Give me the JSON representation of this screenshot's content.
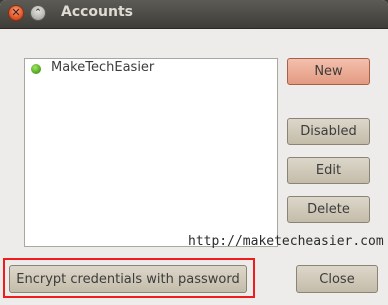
{
  "window": {
    "title": "Accounts",
    "close_glyph": "✕",
    "minimize_glyph": "⌃"
  },
  "accounts": [
    {
      "name": "MakeTechEasier",
      "status_icon": "online-status-icon",
      "status_color": "#4aa117"
    }
  ],
  "buttons": {
    "new": "New",
    "disabled": "Disabled",
    "edit": "Edit",
    "delete": "Delete",
    "encrypt": "Encrypt credentials with password",
    "close": "Close"
  },
  "watermark": "http://maketecheasier.com",
  "colors": {
    "default_button": "#e39a82",
    "highlight": "#ee1c1c",
    "titlebar": "#3e3d39"
  }
}
